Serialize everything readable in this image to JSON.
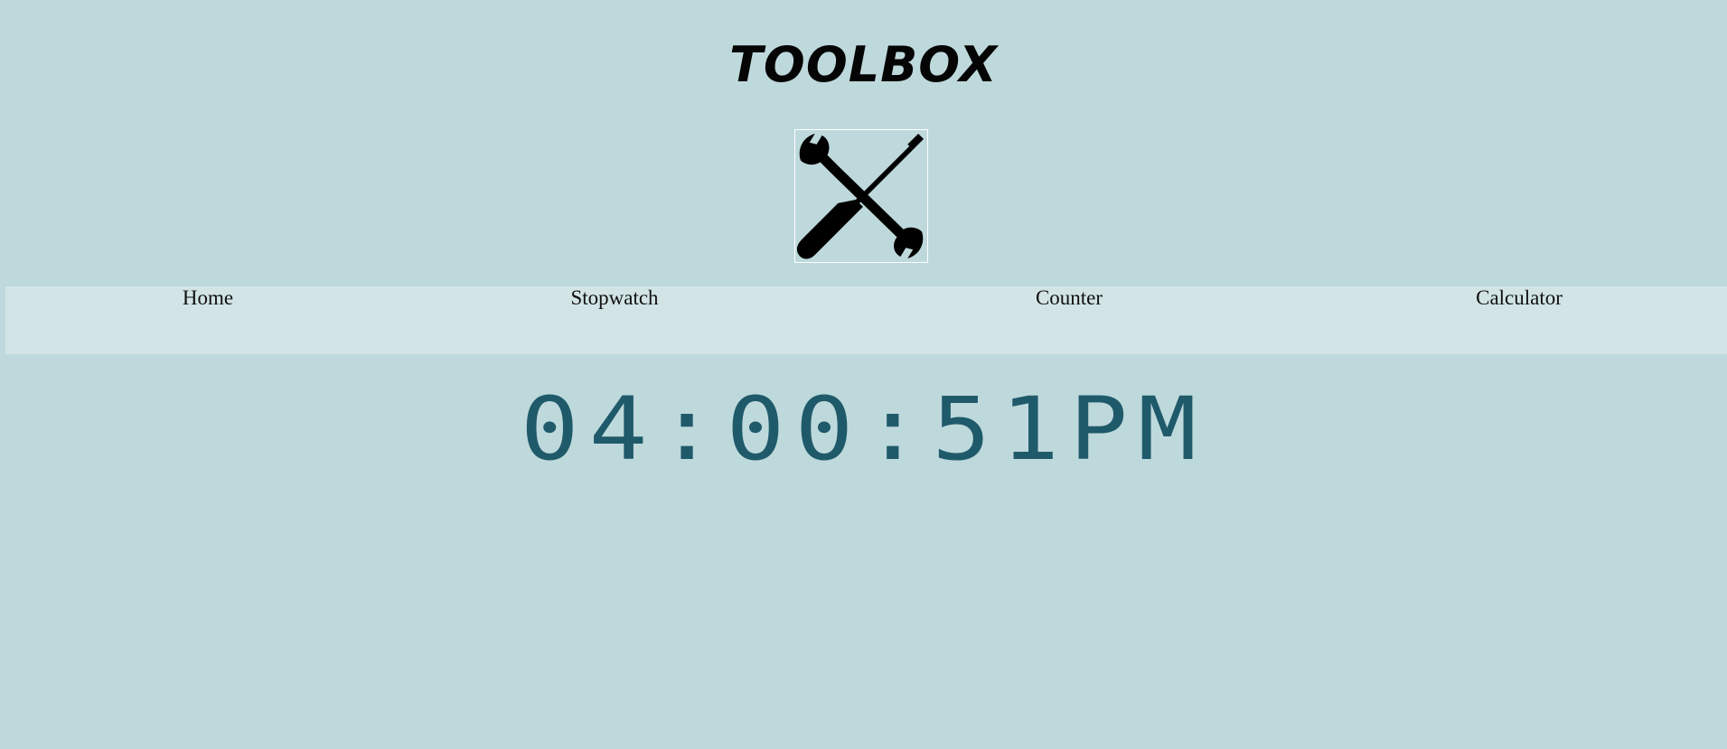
{
  "header": {
    "title": "TOOLBOX",
    "logo_icon": "wrench-screwdriver-icon"
  },
  "nav": {
    "items": [
      {
        "label": "Home"
      },
      {
        "label": "Stopwatch"
      },
      {
        "label": "Counter"
      },
      {
        "label": "Calculator"
      }
    ]
  },
  "clock": {
    "time": "04:00:51PM"
  },
  "colors": {
    "background": "#bed9db",
    "nav_background": "#d2e4e5",
    "clock_color": "#1f5a6b"
  }
}
